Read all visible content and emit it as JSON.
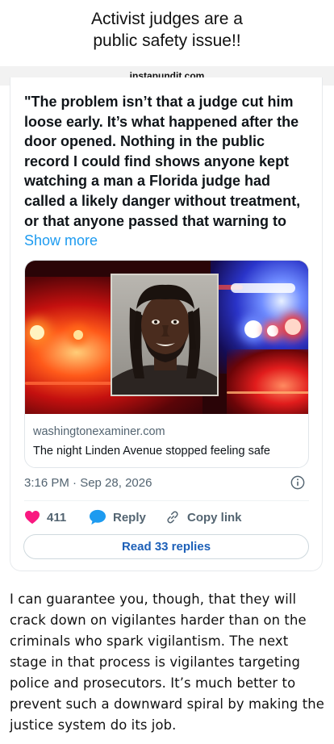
{
  "headline": {
    "line1": "Activist judges are a",
    "line2": "public safety issue!!"
  },
  "source": {
    "domain": "instapundit.com"
  },
  "post": {
    "text": "\"The problem isn’t that a judge cut him loose early. It’s what happened after the door opened. Nothing in the public record I could find shows anyone kept watching a man a Florida judge had called a likely danger without treatment, or that anyone passed that warning to",
    "show_more": "Show more",
    "link_card": {
      "domain": "washingtonexaminer.com",
      "title": "The night Linden Avenue stopped feeling safe"
    },
    "timestamp": "3:16 PM · Sep 28, 2026",
    "actions": {
      "like_count": "411",
      "reply_label": "Reply",
      "copy_link_label": "Copy link"
    },
    "read_replies_label": "Read 33 replies"
  },
  "commentary": "I can guarantee you, though, that they will crack down on vigilantes harder than on the criminals who spark vigilantism. The next stage in that process is vigilantes targeting police and prosecutors. It’s much better to prevent such a downward spiral by making the justice system do its job.",
  "colors": {
    "like": "#f91880",
    "reply": "#1d9bf0",
    "link": "#1d9bf0",
    "replies_button_text": "#1d60b8",
    "muted": "#536471"
  },
  "icons": {
    "like": "heart-icon",
    "reply": "speech-bubble-icon",
    "copy_link": "link-icon",
    "info": "info-icon"
  }
}
